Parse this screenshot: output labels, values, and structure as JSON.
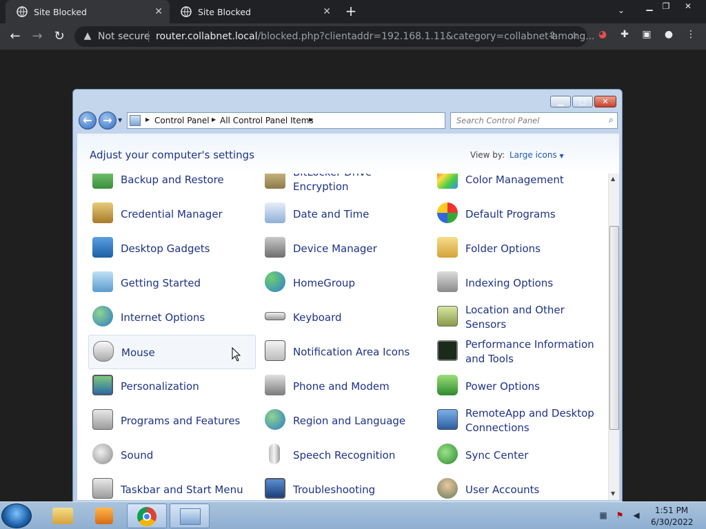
{
  "browser": {
    "tabs": [
      {
        "title": "Site Blocked",
        "active": true
      },
      {
        "title": "Site Blocked",
        "active": false
      }
    ],
    "new_tab": "+",
    "security_label": "Not secure",
    "url_host": "router.collabnet.local",
    "url_rest": "/blocked.php?clientaddr=192.168.1.11&category=collabnet-among..."
  },
  "window": {
    "breadcrumb": [
      "Control Panel",
      "All Control Panel Items"
    ],
    "search_placeholder": "Search Control Panel",
    "heading": "Adjust your computer's settings",
    "view_by_label": "View by:",
    "view_by_value": "Large icons",
    "items": [
      [
        "Backup and Restore",
        "BitLocker Drive Encryption",
        "Color Management"
      ],
      [
        "Credential Manager",
        "Date and Time",
        "Default Programs"
      ],
      [
        "Desktop Gadgets",
        "Device Manager",
        "Folder Options"
      ],
      [
        "Getting Started",
        "HomeGroup",
        "Indexing Options"
      ],
      [
        "Internet Options",
        "Keyboard",
        "Location and Other Sensors"
      ],
      [
        "Mouse",
        "Notification Area Icons",
        "Performance Information and Tools"
      ],
      [
        "Personalization",
        "Phone and Modem",
        "Power Options"
      ],
      [
        "Programs and Features",
        "Region and Language",
        "RemoteApp and Desktop Connections"
      ],
      [
        "Sound",
        "Speech Recognition",
        "Sync Center"
      ],
      [
        "Taskbar and Start Menu",
        "Troubleshooting",
        "User Accounts"
      ]
    ]
  },
  "taskbar": {
    "time": "1:51 PM",
    "date": "6/30/2022"
  }
}
